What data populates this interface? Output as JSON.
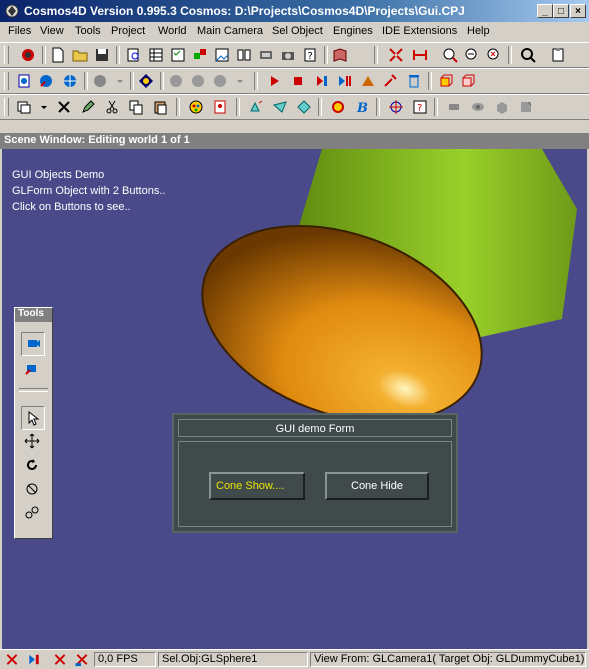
{
  "window": {
    "title": "Cosmos4D Version 0.995.3   Cosmos: D:\\Projects\\Cosmos4D\\Projects\\Gui.CPJ",
    "minimize": "_",
    "maximize": "□",
    "close": "×"
  },
  "menu": [
    "Files",
    "View",
    "Tools",
    "Project",
    "World",
    "Main Camera",
    "Sel Object",
    "Engines",
    "IDE Extensions",
    "Help"
  ],
  "scene": {
    "header": "Scene Window: Editing world 1 of 1",
    "lines": [
      "GUI Objects Demo",
      "GLForm Object with 2 Buttons..",
      "Click on Buttons to see.."
    ]
  },
  "tools": {
    "title": "Tools"
  },
  "gui_form": {
    "title": "GUI demo Form",
    "show_button": "Cone Show....",
    "hide_button": "Cone Hide"
  },
  "status": {
    "fps": "0,0 FPS",
    "selected": "Sel.Obj:GLSphere1",
    "view": "View From: GLCamera1( Target Obj: GLDummyCube1)"
  },
  "colors": {
    "title_bar": "#0a246a",
    "viewport_bg": "#4a4a8a",
    "cone": "#8ac420",
    "sphere": "#e8941a",
    "show_button_text": "#e6e600",
    "hide_button_text": "#ffffff"
  }
}
